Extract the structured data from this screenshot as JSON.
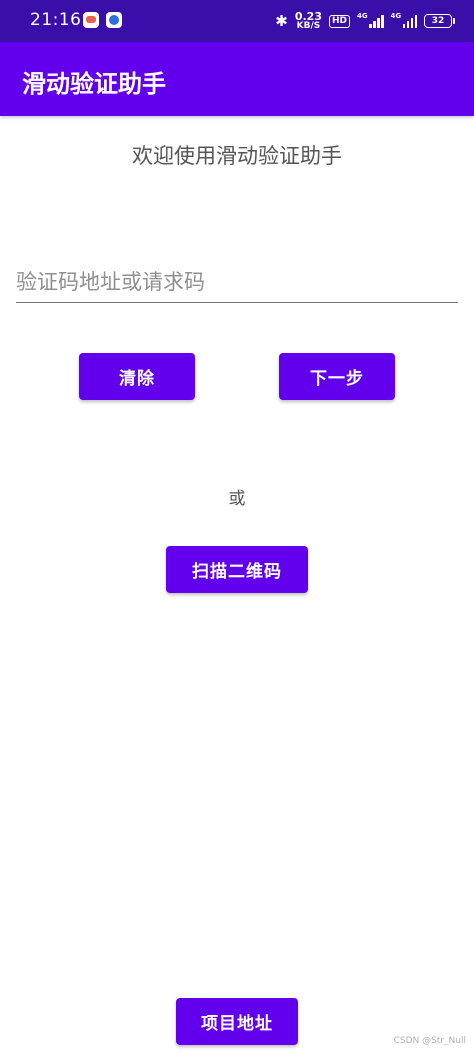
{
  "status_bar": {
    "time": "21:16",
    "speed_value": "0.23",
    "speed_unit": "KB/S",
    "hd_label": "HD",
    "network_1": "4G",
    "network_2": "4G",
    "battery": "32",
    "bluetooth_icon": "bluetooth-icon",
    "background_color": "#3a0ea8"
  },
  "app_bar": {
    "title": "滑动验证助手",
    "color": "#6200ee"
  },
  "main": {
    "welcome": "欢迎使用滑动验证助手",
    "input": {
      "value": "",
      "placeholder": "验证码地址或请求码"
    },
    "clear_label": "清除",
    "next_label": "下一步",
    "or_label": "或",
    "scan_label": "扫描二维码",
    "project_label": "项目地址"
  },
  "watermark": "CSDN @Str_Null",
  "colors": {
    "primary": "#6200ee",
    "text_secondary": "#555555"
  }
}
